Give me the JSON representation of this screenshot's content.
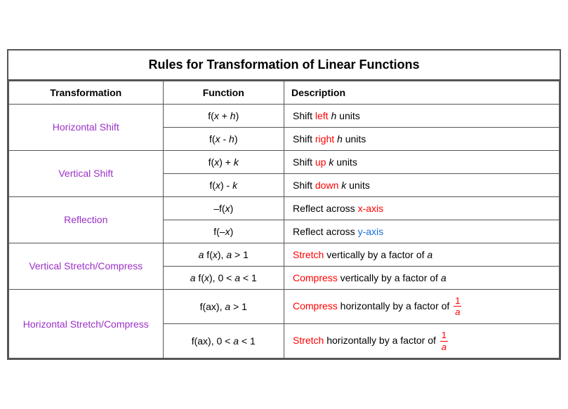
{
  "title": "Rules for Transformation of Linear Functions",
  "headers": {
    "transformation": "Transformation",
    "function": "Function",
    "description": "Description"
  },
  "rows": [
    {
      "transform": "Horizontal Shift",
      "function": "f(x + h)",
      "desc_parts": [
        {
          "text": "Shift ",
          "color": "black"
        },
        {
          "text": "left",
          "color": "red"
        },
        {
          "text": " ",
          "color": "black"
        },
        {
          "text": "h",
          "color": "black",
          "italic": true
        },
        {
          "text": " units",
          "color": "black"
        }
      ]
    },
    {
      "transform": "",
      "function": "f(x  - h)",
      "desc_parts": [
        {
          "text": "Shift ",
          "color": "black"
        },
        {
          "text": "right",
          "color": "red"
        },
        {
          "text": " ",
          "color": "black"
        },
        {
          "text": "h",
          "color": "black",
          "italic": true
        },
        {
          "text": " units",
          "color": "black"
        }
      ]
    },
    {
      "transform": "Vertical Shift",
      "function": "f(x) + k",
      "desc_parts": [
        {
          "text": "Shift ",
          "color": "black"
        },
        {
          "text": "up",
          "color": "red"
        },
        {
          "text": " ",
          "color": "black"
        },
        {
          "text": "k",
          "color": "black",
          "italic": true
        },
        {
          "text": " units",
          "color": "black"
        }
      ]
    },
    {
      "transform": "",
      "function": "f(x) - k",
      "desc_parts": [
        {
          "text": "Shift ",
          "color": "black"
        },
        {
          "text": "down",
          "color": "red"
        },
        {
          "text": " ",
          "color": "black"
        },
        {
          "text": "k",
          "color": "black",
          "italic": true
        },
        {
          "text": " units",
          "color": "black"
        }
      ]
    },
    {
      "transform": "Reflection",
      "function": "–f(x)",
      "desc_parts": [
        {
          "text": "Reflect across ",
          "color": "black"
        },
        {
          "text": "x-axis",
          "color": "red"
        }
      ]
    },
    {
      "transform": "",
      "function": "f(–x)",
      "desc_parts": [
        {
          "text": "Reflect across ",
          "color": "black"
        },
        {
          "text": "y-axis",
          "color": "blue"
        }
      ]
    },
    {
      "transform": "Vertical Stretch/Compress",
      "function": "a f(x), a > 1",
      "desc_parts": [
        {
          "text": "Stretch",
          "color": "red"
        },
        {
          "text": " vertically by a factor of ",
          "color": "black"
        },
        {
          "text": "a",
          "color": "black",
          "italic": true
        }
      ]
    },
    {
      "transform": "",
      "function": "a f(x), 0 < a < 1",
      "desc_parts": [
        {
          "text": "Compress",
          "color": "red"
        },
        {
          "text": " vertically by a factor of ",
          "color": "black"
        },
        {
          "text": "a",
          "color": "black",
          "italic": true
        }
      ]
    },
    {
      "transform": "Horizontal Stretch/Compress",
      "function": "f(ax), a > 1",
      "desc_parts": [
        {
          "text": "Compress",
          "color": "red"
        },
        {
          "text": " horizontally by a factor of ",
          "color": "black"
        }
      ],
      "fraction": true,
      "fraction_color": "red"
    },
    {
      "transform": "",
      "function": "f(ax), 0 < a < 1",
      "desc_parts": [
        {
          "text": "Stretch",
          "color": "red"
        },
        {
          "text": " horizontally by a factor of ",
          "color": "black"
        }
      ],
      "fraction": true,
      "fraction_color": "red"
    }
  ]
}
